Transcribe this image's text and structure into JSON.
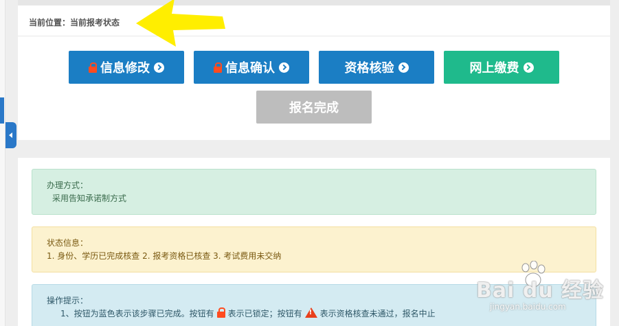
{
  "breadcrumb": {
    "label": "当前位置：",
    "current": "当前报考状态"
  },
  "steps": [
    {
      "label": "信息修改",
      "locked": true,
      "color": "#1b7ec4"
    },
    {
      "label": "信息确认",
      "locked": true,
      "color": "#1b7ec4"
    },
    {
      "label": "资格核验",
      "locked": false,
      "color": "#1b7ec4"
    },
    {
      "label": "网上缴费",
      "locked": false,
      "color": "#1fba8c"
    },
    {
      "label": "报名完成",
      "locked": false,
      "color": "#bdbdbd"
    }
  ],
  "alerts": {
    "method": {
      "title": "办理方式：",
      "content": "采用告知承诺制方式"
    },
    "status": {
      "title": "状态信息：",
      "content": "1. 身份、学历已完成核查 2. 报考资格已核查 3. 考试费用未交纳"
    },
    "tips": {
      "title": "操作提示：",
      "line_prefix": "1、按钮为蓝色表示该步骤已完成。按钮有",
      "line_mid": "表示已锁定；按钮有",
      "line_suffix": "表示资格核查未通过，报名中止"
    }
  },
  "watermark": {
    "brand": "Bai du 经验",
    "url": "jingyan.baidu.com"
  },
  "icons": {
    "lock": "lock-icon",
    "arrow": "arrow-right-circle-icon",
    "warning": "warning-icon",
    "collapse": "chevron-left-icon"
  }
}
